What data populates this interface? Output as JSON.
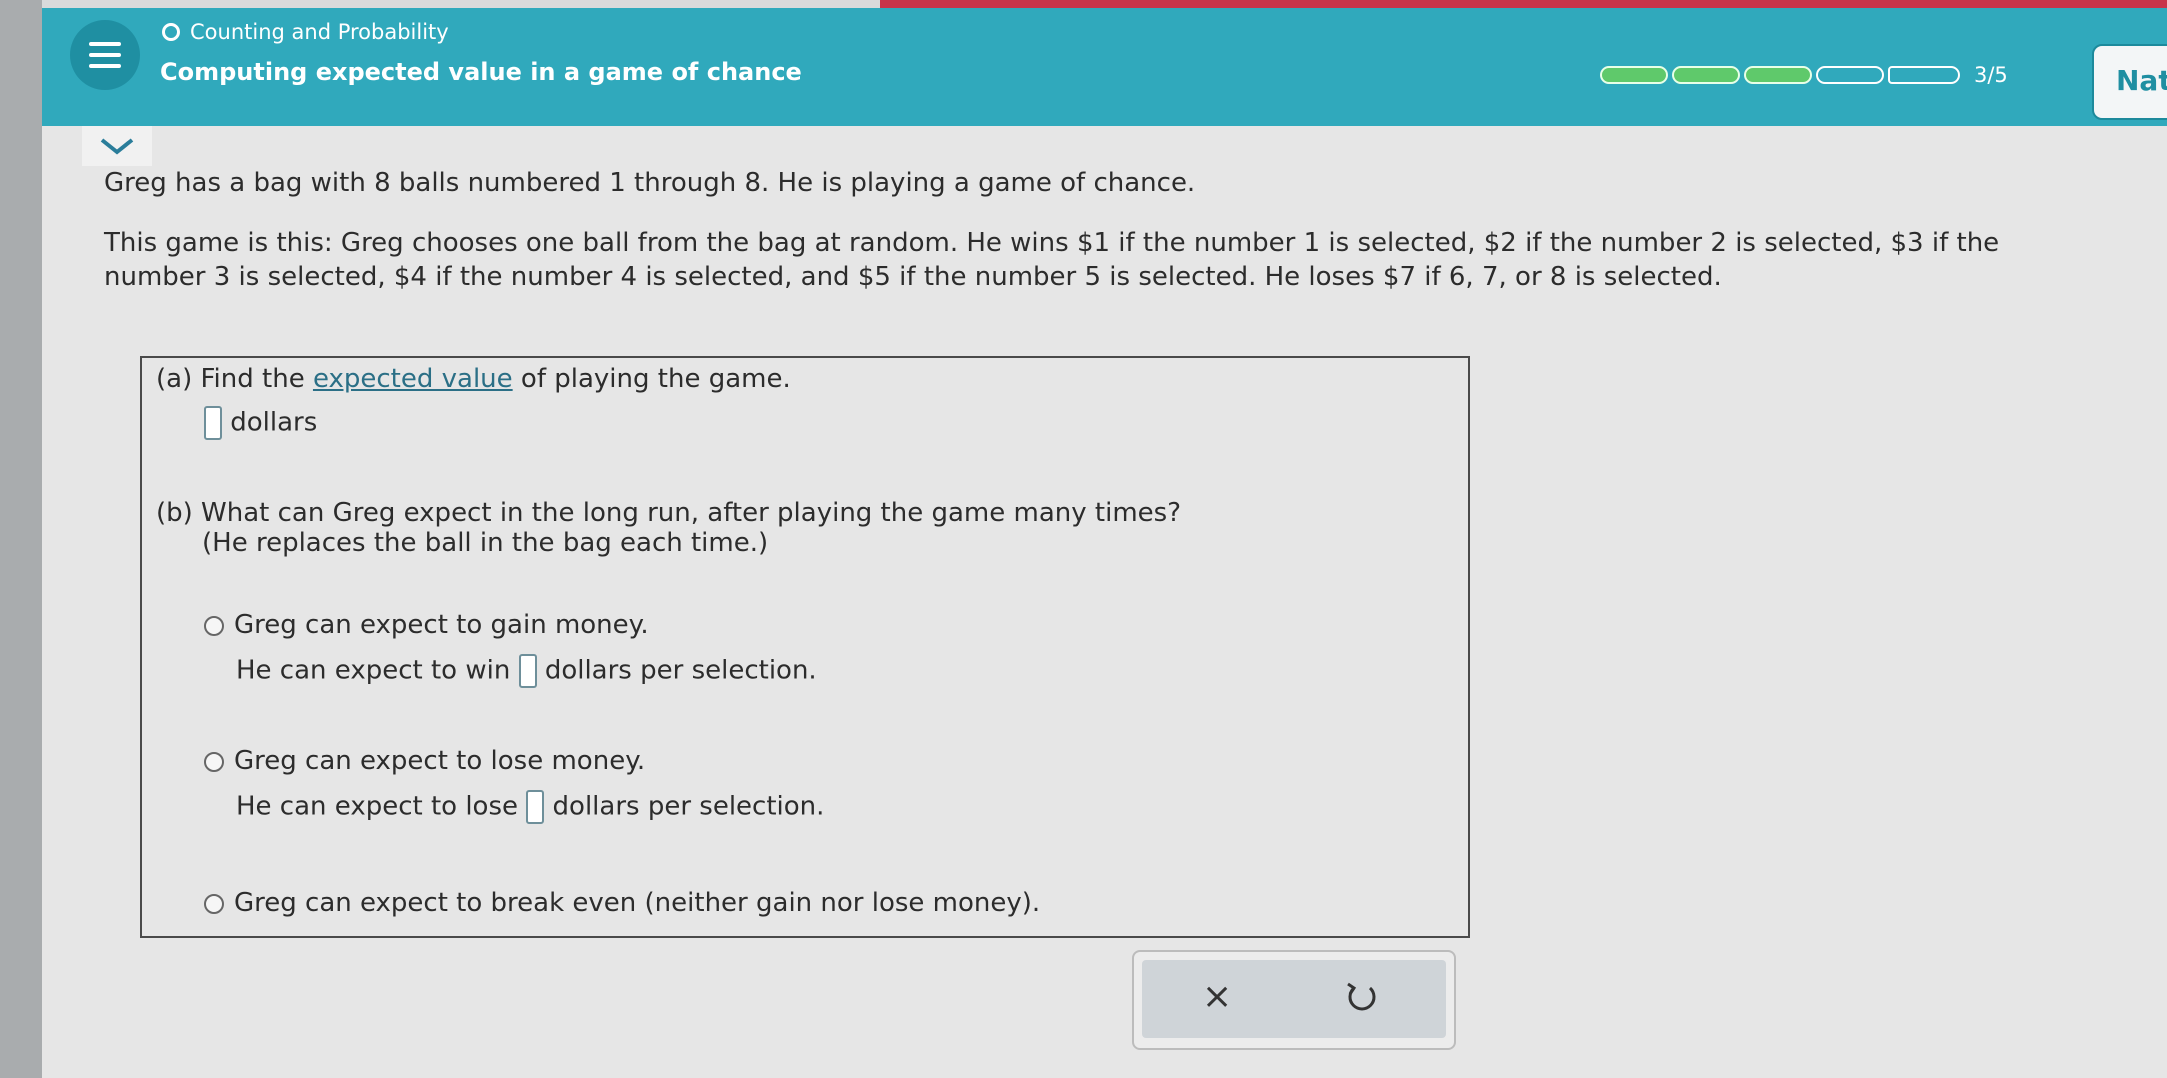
{
  "header": {
    "topic": "Counting and Probability",
    "lesson_title": "Computing expected value in a game of chance",
    "progress": {
      "completed": 3,
      "total": 5,
      "text": "3/5"
    },
    "next_label": "Nat"
  },
  "problem": {
    "line1": "Greg has a bag with 8 balls numbered 1 through 8. He is playing a game of chance.",
    "line2": "This game is this: Greg chooses one ball from the bag at random. He wins $1 if the number 1 is selected, $2 if the number 2 is selected, $3 if the number 3 is selected, $4 if the number 4 is selected, and $5 if the number 5 is selected. He loses $7 if 6, 7, or 8 is selected."
  },
  "part_a": {
    "prefix": "(a) Find the",
    "link": "expected value",
    "suffix": "of playing the game.",
    "unit": "dollars"
  },
  "part_b": {
    "question": "(b) What can Greg expect in the long run, after playing the game many times?",
    "note": "(He replaces the ball in the bag each time.)",
    "options": [
      {
        "label": "Greg can expect to gain money.",
        "sub_prefix": "He can expect to win",
        "sub_suffix": "dollars per selection."
      },
      {
        "label": "Greg can expect to lose money.",
        "sub_prefix": "He can expect to lose",
        "sub_suffix": "dollars per selection."
      },
      {
        "label": "Greg can expect to break even (neither gain nor lose money)."
      }
    ]
  },
  "actions": {
    "clear": "×"
  },
  "colors": {
    "header": "#30a9bc",
    "accent": "#1f8fa2",
    "progress_done": "#5fc96b"
  }
}
